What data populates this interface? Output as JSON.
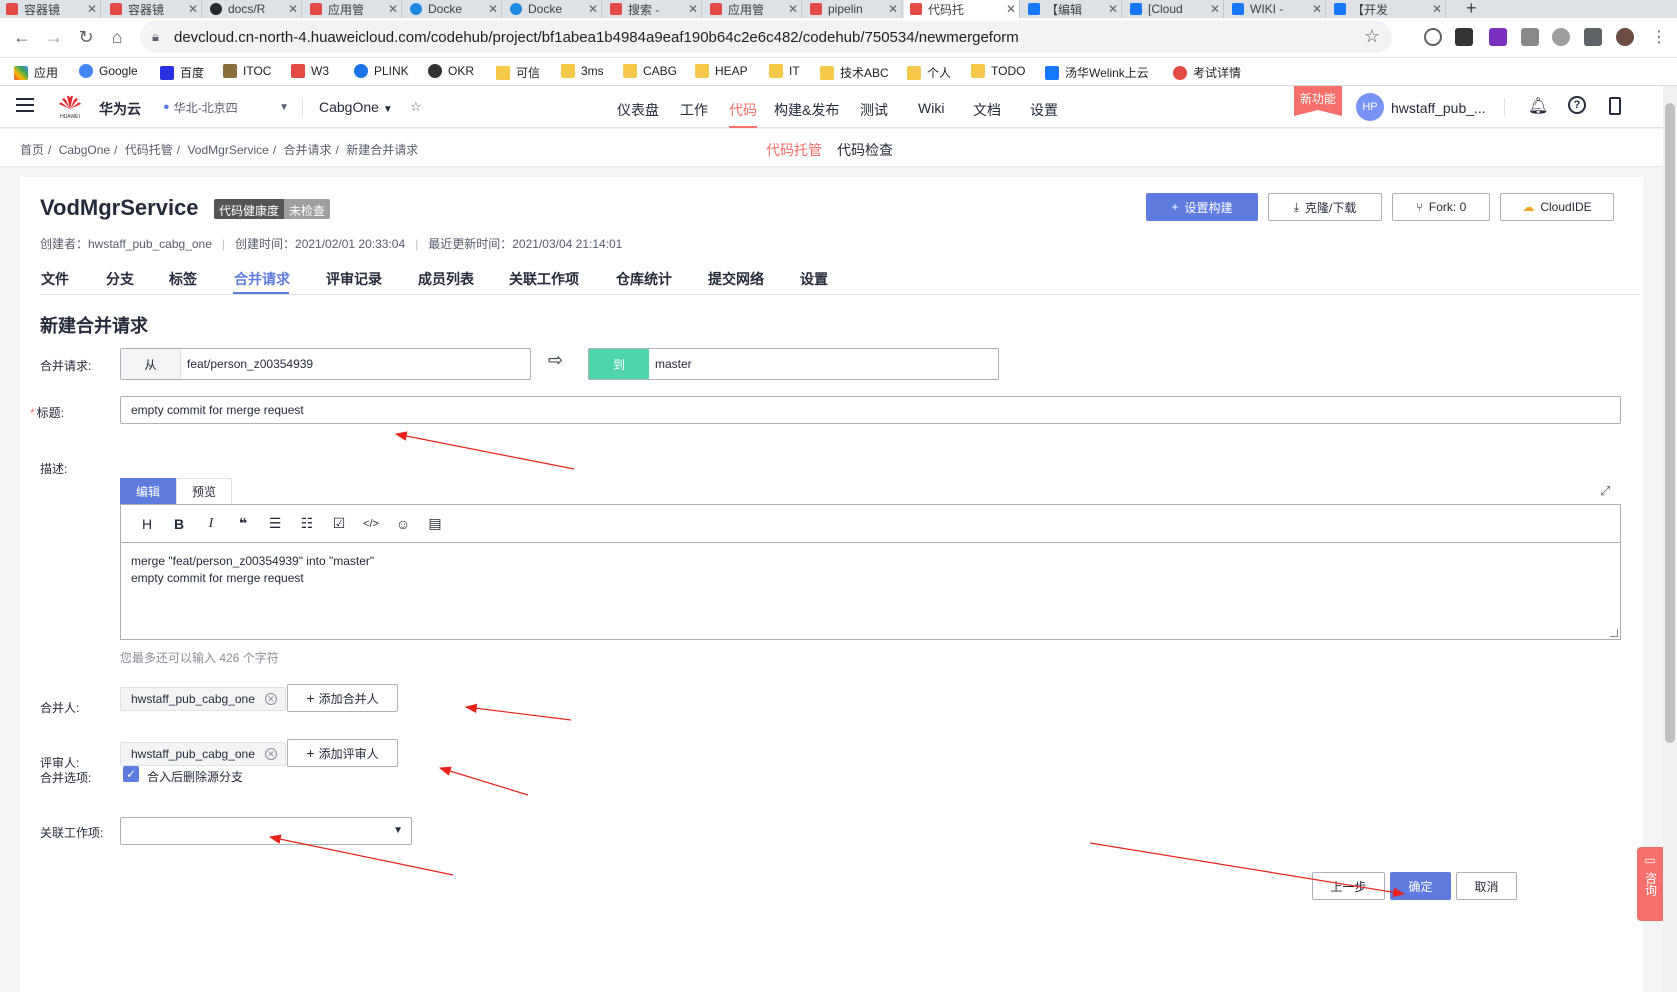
{
  "browser": {
    "tabs": [
      {
        "label": "容器镜"
      },
      {
        "label": "容器镜"
      },
      {
        "label": "docs/R"
      },
      {
        "label": "应用管"
      },
      {
        "label": "Docke"
      },
      {
        "label": "Docke"
      },
      {
        "label": "搜索 -"
      },
      {
        "label": "应用管"
      },
      {
        "label": "pipelin"
      },
      {
        "label": "代码托"
      },
      {
        "label": "【编辑"
      },
      {
        "label": "[Cloud"
      },
      {
        "label": "WIKI -"
      },
      {
        "label": "【开发"
      }
    ],
    "url": "devcloud.cn-north-4.huaweicloud.com/codehub/project/bf1abea1b4984a9eaf190b64c2e6c482/codehub/750534/newmergeform",
    "bookmarks": [
      "应用",
      "Google",
      "百度",
      "ITOC",
      "W3",
      "PLINK",
      "OKR",
      "可信",
      "3ms",
      "CABG",
      "HEAP",
      "IT",
      "技术ABC",
      "个人",
      "TODO",
      "汤华Welink上云",
      "考试详情"
    ]
  },
  "header": {
    "logo_text": "HUAWEI",
    "brand": "华为云",
    "region": "华北-北京四",
    "project": "CabgOne",
    "nav": [
      "仪表盘",
      "工作",
      "代码",
      "构建&发布",
      "测试",
      "Wiki",
      "文档",
      "设置"
    ],
    "new_feature": "新功能",
    "avatar": "HP",
    "username": "hwstaff_pub_..."
  },
  "subheader": {
    "breadcrumb": [
      "首页",
      "CabgOne",
      "代码托管",
      "VodMgrService",
      "合并请求",
      "新建合并请求"
    ],
    "tabs": [
      "代码托管",
      "代码检查"
    ]
  },
  "repo": {
    "name": "VodMgrService",
    "health_label": "代码健康度",
    "health_value": "未检查",
    "creator": "创建者：hwstaff_pub_cabg_one",
    "created": "创建时间：2021/02/01 20:33:04",
    "updated": "最近更新时间：2021/03/04 21:14:01",
    "buttons": {
      "build": "设置构建",
      "clone": "克隆/下载",
      "fork": "Fork: 0",
      "ide": "CloudIDE"
    },
    "tabs": [
      "文件",
      "分支",
      "标签",
      "合并请求",
      "评审记录",
      "成员列表",
      "关联工作项",
      "仓库统计",
      "提交网络",
      "设置"
    ]
  },
  "form": {
    "title": "新建合并请求",
    "merge_label": "合并请求:",
    "from_prefix": "从",
    "from_branch": "feat/person_z00354939",
    "to_prefix": "到",
    "to_branch": "master",
    "title_label": "标题:",
    "title_value": "empty commit for merge request",
    "desc_label": "描述:",
    "editor_tabs": [
      "编辑",
      "预览"
    ],
    "toolbar_icons": [
      "heading-icon",
      "bold-icon",
      "italic-icon",
      "quote-icon",
      "bullet-list-icon",
      "ordered-list-icon",
      "task-list-icon",
      "code-icon",
      "emoji-icon",
      "file-icon"
    ],
    "desc_line1": "merge \"feat/person_z00354939\" into \"master\"",
    "desc_line2": "empty commit for merge request",
    "char_count": "您最多还可以输入 426 个字符",
    "merger_label": "合并人:",
    "merger": "hwstaff_pub_cabg_one",
    "add_merger": "添加合并人",
    "reviewer_label": "评审人:",
    "reviewer": "hwstaff_pub_cabg_one",
    "add_reviewer": "添加评审人",
    "option_label": "合并选项:",
    "option_text": "合入后删除源分支",
    "option_checked": true,
    "workitem_label": "关联工作项:",
    "workitem_value": "",
    "prev": "上一步",
    "confirm": "确定",
    "cancel": "取消"
  },
  "consult": "咨询",
  "colors": {
    "accent": "#5e7ce0",
    "brand_red": "#f66f6a",
    "to_green": "#50d4ab",
    "annotation_arrow": "#e8231c"
  }
}
